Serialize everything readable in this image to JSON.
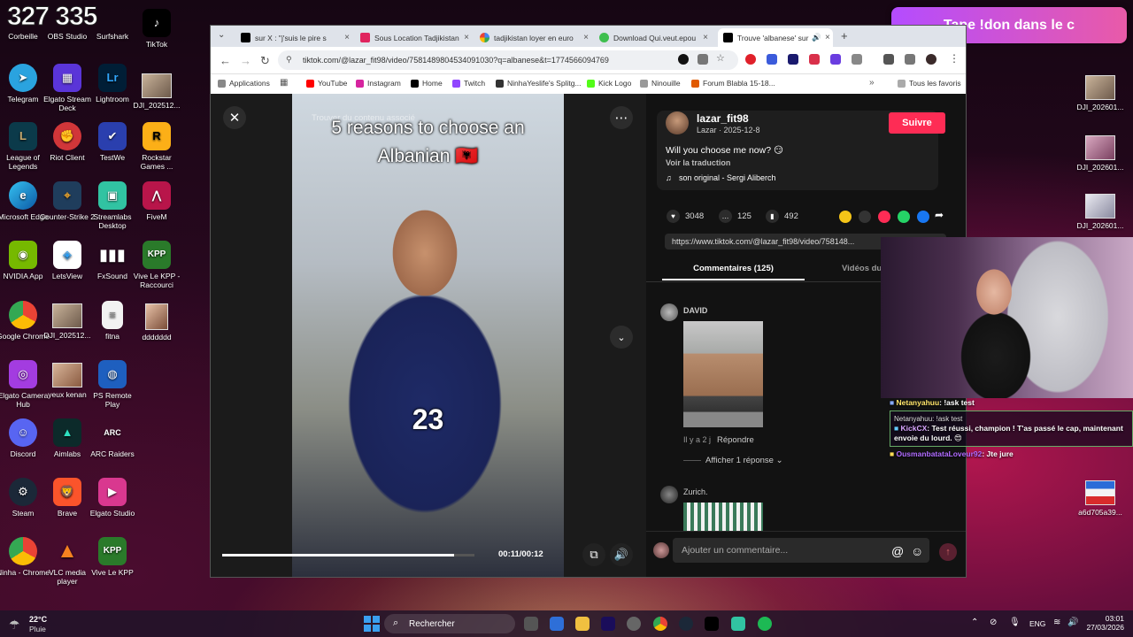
{
  "counter": "327 335",
  "banner": "Tape !don dans le c",
  "desktop": {
    "col1": [
      "Corbeille",
      "Telegram",
      "League of Legends",
      "Microsoft Edge",
      "NVIDIA App",
      "Google Chrome",
      "Elgato Camera Hub",
      "Discord",
      "Steam",
      "Ninha - Chrome"
    ],
    "col2": [
      "OBS Studio",
      "Elgato Stream Deck",
      "Riot Client",
      "Counter-Strike 2",
      "LetsView",
      "DJI_202512...",
      "yeux kenan",
      "Aimlabs",
      "Brave",
      "VLC media player"
    ],
    "col3": [
      "Surfshark",
      "Lightroom",
      "TestWe",
      "Streamlabs Desktop",
      "FxSound",
      "fitna",
      "PS Remote Play",
      "ARC Raiders",
      "Elgato Studio",
      "Vive Le KPP"
    ],
    "col4": [
      "TikTok",
      "DJI_202512...",
      "Rockstar Games ...",
      "FiveM",
      "Vive Le KPP - Raccourci",
      "ddddddd"
    ],
    "right": [
      "DJI_202601...",
      "DJI_202601...",
      "DJI_202601...",
      "a6d705a39..."
    ]
  },
  "browser": {
    "tabs": [
      "sur X : \"j'suis le pire s",
      "Sous Location Tadjikistan",
      "tadjikistan loyer en euro",
      "Download Qui.veut.epou",
      "Trouve 'albanese' sur"
    ],
    "url": "tiktok.com/@lazar_fit98/video/7581489804534091030?q=albanese&t=1774566094769",
    "bookmarks": [
      "Applications",
      "YouTube",
      "Instagram",
      "Home",
      "Twitch",
      "NinhaYeslife's Splitg...",
      "Kick Logo",
      "Ninouille",
      "Forum Blabla 15-18...",
      "Tous les favoris"
    ]
  },
  "video": {
    "overlay": "Trouver du contenu associé",
    "caption_line1": "5 reasons to choose an",
    "caption_line2": "Albanian 🇦🇱",
    "number": "23",
    "time": "00:11/00:12",
    "progress": 0.92
  },
  "post": {
    "username": "lazar_fit98",
    "meta": "Lazar · 2025-12-8",
    "follow": "Suivre",
    "caption": "Will you choose me now? 😏",
    "translate": "Voir la traduction",
    "sound": "son original - Sergi Aliberch",
    "likes": "3048",
    "comments": "125",
    "saves": "492",
    "link": "https://www.tiktok.com/@lazar_fit98/video/758148...",
    "tab_comments": "Commentaires (125)",
    "tab_videos": "Vidéos du",
    "comment1_user": "DAVID",
    "comment1_time": "Il y a 2 j",
    "comment1_reply": "Répondre",
    "show_replies": "Afficher 1 réponse",
    "comment2_user": "Zurich.",
    "input_placeholder": "Ajouter un commentaire..."
  },
  "chat": {
    "line1_user": "Netanyahuu",
    "line1_text": ": !ask test",
    "box_quote": "Netanyahuu: !ask test",
    "box_user": "KickCX",
    "box_text": ": Test réussi, champion ! T'as passé le cap, maintenant envoie du lourd. 😍",
    "line3_user": "OusmanbatataLoveur92",
    "line3_text": ": Jte jure"
  },
  "taskbar": {
    "weather_temp": "22°C",
    "weather_desc": "Pluie",
    "search": "Rechercher",
    "lang": "ENG",
    "time": "03:01",
    "date": "27/03/2026"
  }
}
